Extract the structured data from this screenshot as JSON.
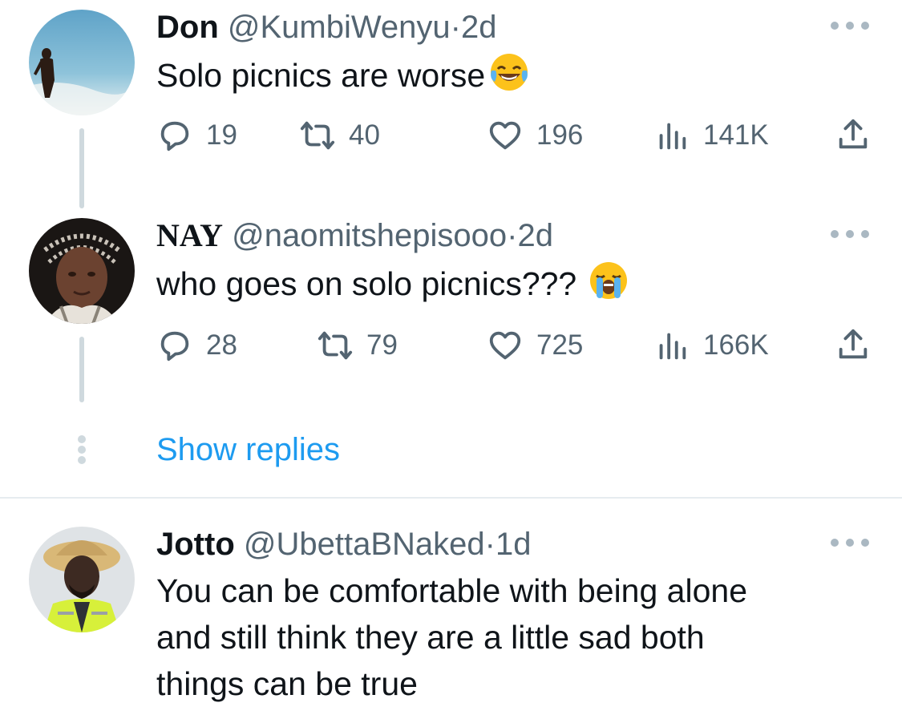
{
  "tweets": [
    {
      "name": "Don",
      "handle": "@KumbiWenyu",
      "separator": "·",
      "time": "2d",
      "text": "Solo picnics are worse",
      "emoji": "face-with-tears-of-joy",
      "replies": "19",
      "retweets": "40",
      "likes": "196",
      "views": "141K"
    },
    {
      "name": "NAY",
      "handle": "@naomitshepisooo",
      "separator": "·",
      "time": "2d",
      "text": "who goes on solo picnics???",
      "emoji": "loudly-crying-face",
      "replies": "28",
      "retweets": "79",
      "likes": "725",
      "views": "166K"
    },
    {
      "name": "Jotto",
      "handle": "@UbettaBNaked",
      "separator": "·",
      "time": "1d",
      "text_lines": [
        "You can be comfortable with being alone",
        "and still think they are a little sad both",
        "things can be true"
      ]
    }
  ],
  "show_replies_label": "Show replies",
  "colors": {
    "text": "#0f1419",
    "secondary": "#536471",
    "link": "#1d9bf0",
    "thread_line": "#cfd9de"
  }
}
